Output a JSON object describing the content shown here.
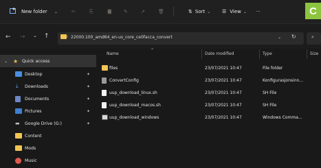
{
  "toolbar": {
    "new_label": "New folder",
    "sort_label": "Sort",
    "view_label": "View",
    "brand_letter": "C"
  },
  "address": {
    "path": "22000.100_amd64_en-us_core_ce0facca_convert"
  },
  "columns": {
    "name": "Name",
    "date": "Date modified",
    "type": "Type",
    "size": "Size"
  },
  "sidebar": {
    "items": [
      {
        "label": "Quick access",
        "icon": "star-icon"
      },
      {
        "label": "Desktop",
        "icon": "desktop-icon"
      },
      {
        "label": "Downloads",
        "icon": "download-icon"
      },
      {
        "label": "Documents",
        "icon": "documents-icon"
      },
      {
        "label": "Pictures",
        "icon": "pictures-icon"
      },
      {
        "label": "Google Drive (G:)",
        "icon": "drive-icon"
      },
      {
        "label": "Content",
        "icon": "folder-icon"
      },
      {
        "label": "Mods",
        "icon": "folder-icon"
      },
      {
        "label": "Music",
        "icon": "music-icon"
      }
    ]
  },
  "files": [
    {
      "name": "files",
      "date": "23/07/2021 10:47",
      "type": "File folder",
      "icon": "folder-icon"
    },
    {
      "name": "ConvertConfig",
      "date": "23/07/2021 10:47",
      "type": "Konfigurasjonsinn...",
      "icon": "config-file-icon"
    },
    {
      "name": "uup_download_linux.sh",
      "date": "23/07/2021 10:47",
      "type": "SH File",
      "icon": "file-icon"
    },
    {
      "name": "uup_download_macos.sh",
      "date": "23/07/2021 10:47",
      "type": "SH File",
      "icon": "file-icon"
    },
    {
      "name": "uup_download_windows",
      "date": "23/07/2021 10:47",
      "type": "Windows Comma...",
      "icon": "cmd-file-icon"
    }
  ],
  "colors": {
    "folder": "#f1c453",
    "accent": "#8dc43f",
    "selection": "#333333"
  }
}
